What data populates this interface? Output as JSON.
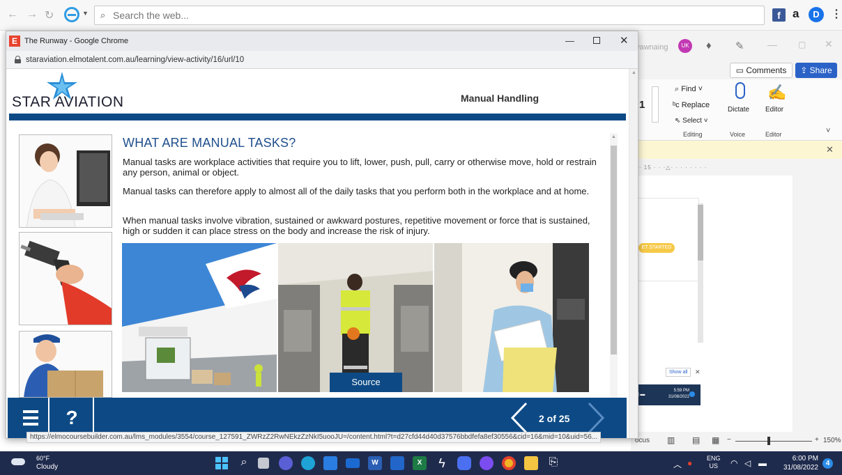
{
  "ie_bar": {
    "search_value": "",
    "search_placeholder": "Search the web...",
    "ext_fb": "f",
    "ext_a": "a",
    "ext_d": "D"
  },
  "word": {
    "user_name": "yawnaing",
    "avatar_initials": "UK",
    "comments_label": "Comments",
    "share_label": "Share",
    "font_size_value": "1",
    "find_label": "Find",
    "replace_label": "Replace",
    "select_label": "Select",
    "dictate_label": "Dictate",
    "editor_label": "Editor",
    "groups": [
      "Editing",
      "Voice",
      "Editor"
    ],
    "ruler": "· · 15 · · ·△· · · · · · · ·",
    "status_pill": "ET STARTED",
    "show_all": "Show all",
    "inner_time": "5:59 PM",
    "inner_date": "31/08/2022",
    "focus_label": "ocus",
    "zoom": "150%"
  },
  "chrome": {
    "title": "The Runway - Google Chrome",
    "favicon_letter": "E",
    "url": "staraviation.elmotalent.com.au/learning/view-activity/16/url/10",
    "status_url": "https://elmocoursebuilder.com.au/lms_modules/3554/course_127591_ZWRzZ2RwNEkzZzNkI5uooJU=/content.html?t=d27cfd44d40d37576bbdfefa8ef30556&cid=16&mid=10&uid=56..."
  },
  "course": {
    "logo": "STAR AVIATION",
    "module_title": "Manual Handling",
    "heading": "WHAT ARE MANUAL TASKS?",
    "paragraphs": [
      "Manual tasks are workplace activities that require you to lift, lower, push, pull, carry or otherwise move, hold or restrain any person, animal or object.",
      "Manual tasks can therefore apply to almost all of the daily tasks that you perform both in the workplace and at home.",
      "When manual tasks involve vibration, sustained or awkward postures, repetitive movement or force that is sustained, high or sudden it can place stress on the body and increase the risk of injury."
    ],
    "source_label": "Source",
    "page_counter": "2 of 25",
    "help_label": "?"
  },
  "taskbar": {
    "temp": "60°F",
    "weather": "Cloudy",
    "lang_line1": "ENG",
    "lang_line2": "US",
    "time": "6:00 PM",
    "date": "31/08/2022",
    "notification_count": "4"
  },
  "colors": {
    "brand_blue": "#0d4a85",
    "heading_blue": "#1f4e8c",
    "accent_star": "#2a8fd8",
    "taskbar": "#1f2b4d"
  }
}
